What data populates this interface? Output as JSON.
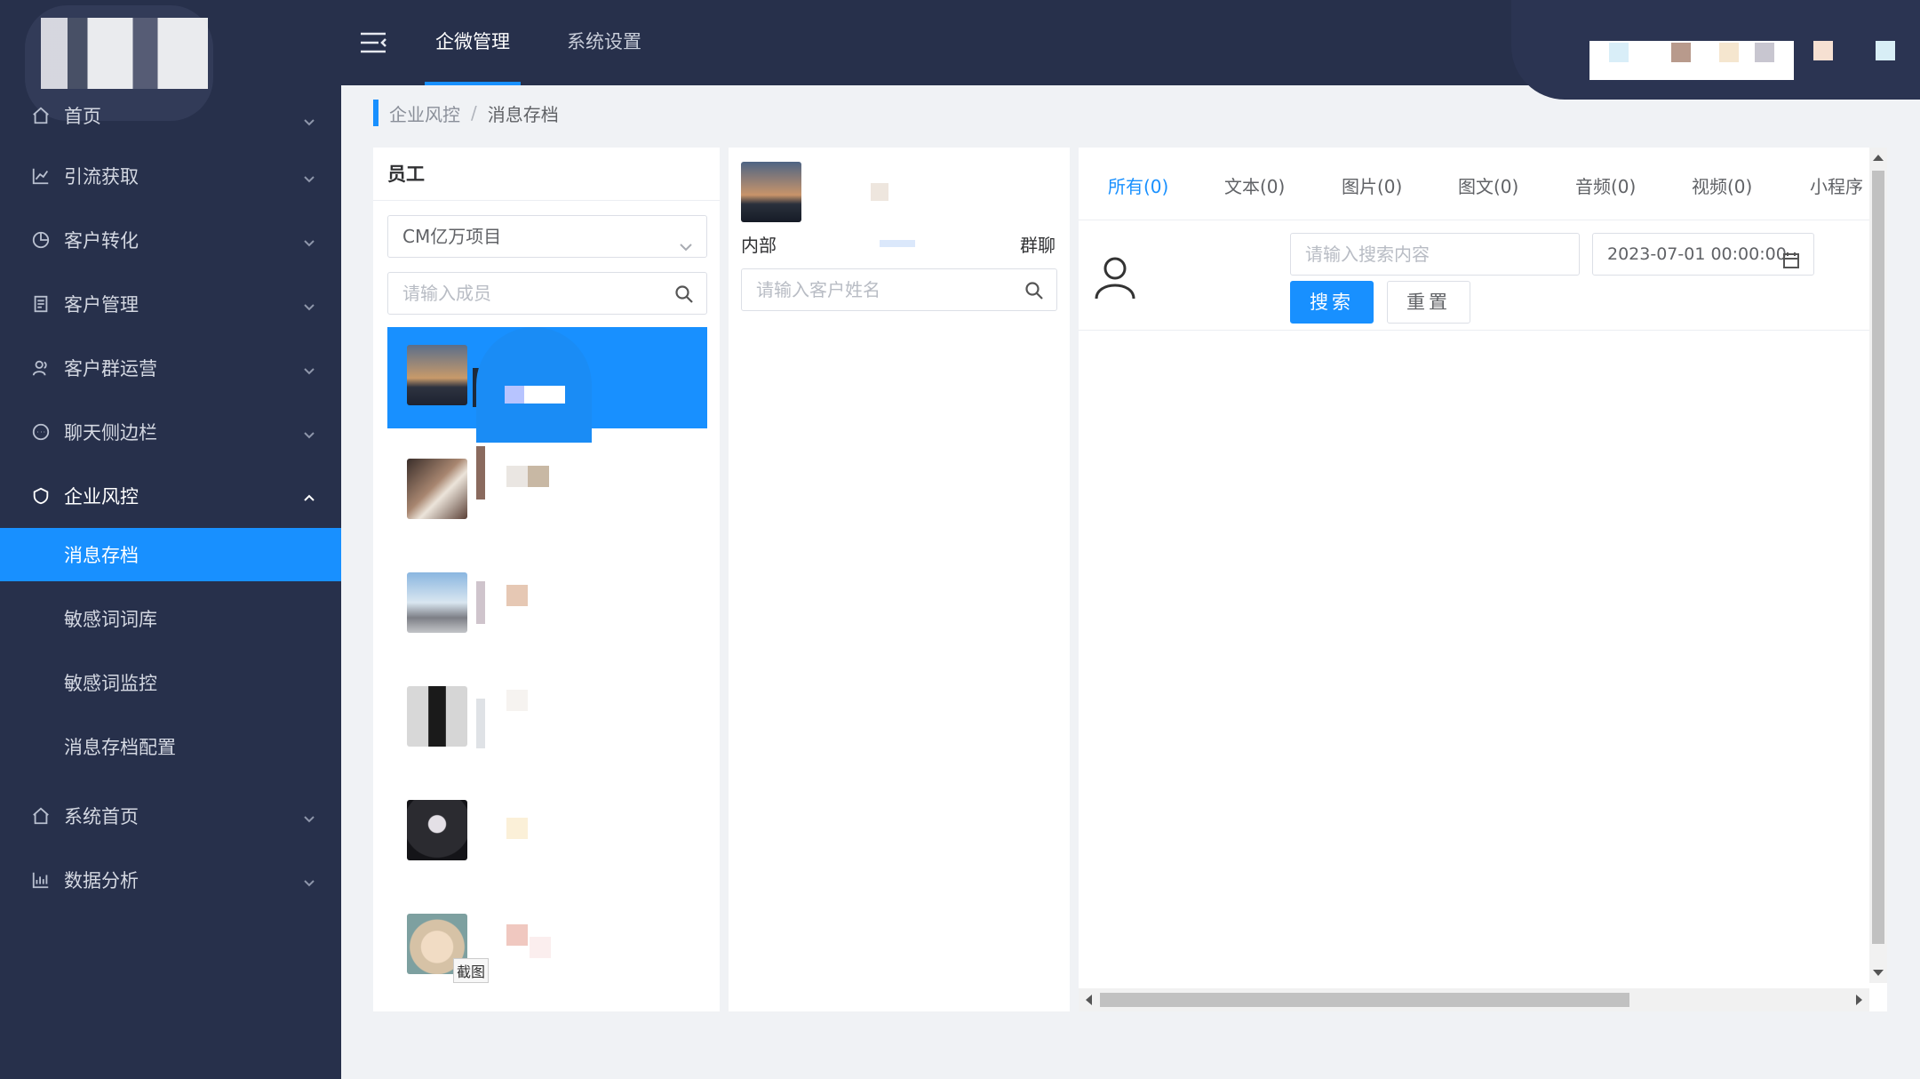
{
  "sidebar": {
    "items": [
      {
        "label": "首页",
        "icon": "home-icon"
      },
      {
        "label": "引流获取",
        "icon": "chart-line-icon"
      },
      {
        "label": "客户转化",
        "icon": "pie-chart-icon"
      },
      {
        "label": "客户管理",
        "icon": "clipboard-icon"
      },
      {
        "label": "客户群运营",
        "icon": "users-icon"
      },
      {
        "label": "聊天侧边栏",
        "icon": "chat-icon"
      },
      {
        "label": "企业风控",
        "icon": "shield-icon"
      }
    ],
    "sub_items": [
      {
        "label": "消息存档",
        "active": true
      },
      {
        "label": "敏感词词库"
      },
      {
        "label": "敏感词监控"
      },
      {
        "label": "消息存档配置"
      }
    ],
    "bottom_items": [
      {
        "label": "系统首页",
        "icon": "home-icon"
      },
      {
        "label": "数据分析",
        "icon": "bar-chart-icon"
      }
    ]
  },
  "topbar": {
    "tabs": [
      {
        "label": "企微管理",
        "active": true
      },
      {
        "label": "系统设置"
      }
    ]
  },
  "breadcrumb": {
    "parent": "企业风控",
    "separator": "/",
    "current": "消息存档"
  },
  "employee_panel": {
    "title": "员工",
    "project_select": "CM亿万项目",
    "member_search_placeholder": "请输入成员"
  },
  "customer_panel": {
    "tab_internal": "内部",
    "tab_group": "群聊",
    "customer_search_placeholder": "请输入客户姓名"
  },
  "message_panel": {
    "tabs": [
      {
        "label": "所有(0)",
        "active": true
      },
      {
        "label": "文本(0)"
      },
      {
        "label": "图片(0)"
      },
      {
        "label": "图文(0)"
      },
      {
        "label": "音频(0)"
      },
      {
        "label": "视频(0)"
      },
      {
        "label": "小程序"
      }
    ],
    "search_placeholder": "请输入搜索内容",
    "start_date": "2023-07-01 00:00:00",
    "search_button": "搜索",
    "reset_button": "重置"
  },
  "screenshot_tag": "截图",
  "colors": {
    "sidebar_bg": "#27304b",
    "accent": "#1890ff",
    "page_bg": "#f0f2f5"
  }
}
